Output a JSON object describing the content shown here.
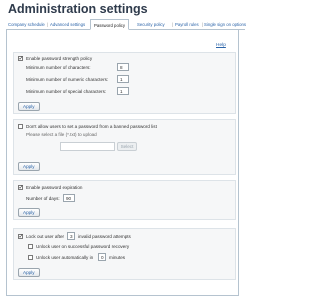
{
  "page": {
    "title": "Administration settings"
  },
  "tabs": [
    {
      "label": "Company schedule"
    },
    {
      "label": "Advanced settings"
    },
    {
      "label": "Password policy"
    },
    {
      "label": "Security policy"
    },
    {
      "label": "Payroll rules"
    },
    {
      "label": "Single sign on options"
    }
  ],
  "help": {
    "label": "Help"
  },
  "strength": {
    "enable_label": "Enable password strength policy",
    "checked": true,
    "min_chars_label": "Minimum number of characters:",
    "min_chars_value": "8",
    "min_numeric_label": "Minimum number of numeric characters:",
    "min_numeric_value": "1",
    "min_special_label": "Minimum number of special characters:",
    "min_special_value": "1",
    "apply_label": "Apply"
  },
  "banned": {
    "label": "Don't allow users to set a password from a banned password list",
    "checked": false,
    "hint": "Please select a file (*.txt) to upload",
    "select_label": "Select",
    "apply_label": "Apply"
  },
  "expiration": {
    "label": "Enable password expiration",
    "checked": true,
    "days_label": "Number of days:",
    "days_value": "90",
    "apply_label": "Apply"
  },
  "lockout": {
    "label_before": "Lock out user after",
    "attempts_value": "3",
    "label_after": "invalid password attempts",
    "checked": true,
    "unlock_on_recovery_label": "Unlock user on successful password recovery",
    "unlock_auto_before": "Unlock user automatically in",
    "unlock_auto_value": "0",
    "unlock_auto_after": "minutes",
    "apply_label": "Apply"
  }
}
